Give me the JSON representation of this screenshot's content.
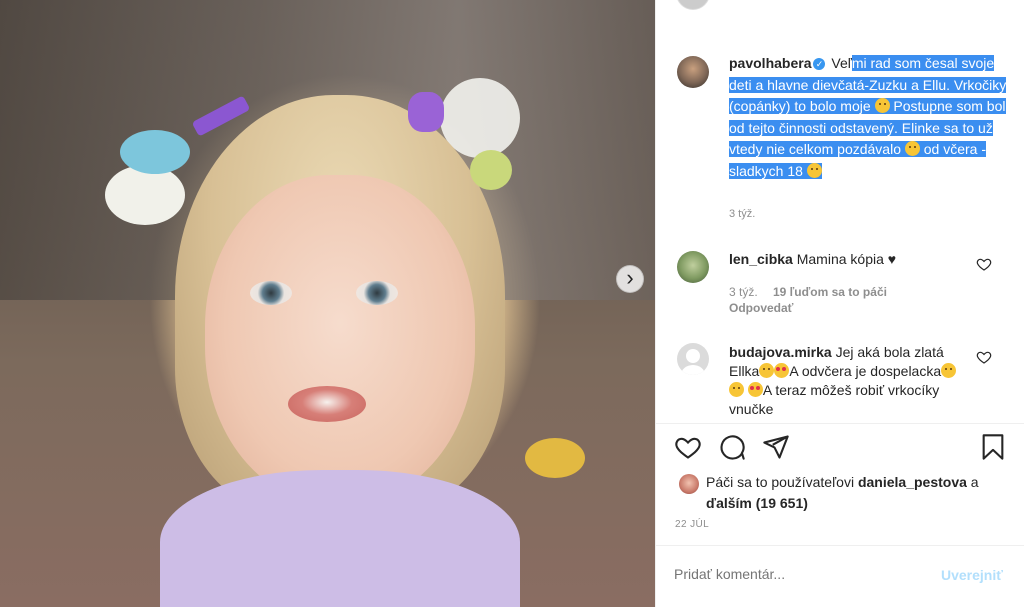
{
  "post": {
    "author": "pavolhabera",
    "caption_plain": "Veľ",
    "caption_highlighted_1": "mi rad som česal svoje deti a hlavne dievčatá-Zuzku a Ellu. Vrkočiky (copánky) to bolo moje ",
    "caption_highlighted_2": " Postupne som bol od tejto činnosti odstavený. Elinke sa to už vtedy nie celkom pozdávalo ",
    "caption_highlighted_3": " od včera - sladkych 18 ",
    "caption_time": "3 týž.",
    "likes_prefix": "Páči sa to používateľovi",
    "likes_user": "daniela_pestova",
    "likes_mid": "a",
    "likes_rest": "ďalším (19 651)",
    "date": "22 JÚL"
  },
  "comments": [
    {
      "user": "len_cibka",
      "text": "Mamina kópia ♥",
      "time": "3 týž.",
      "likes": "19 ľuďom sa to páči",
      "reply": "Odpovedať"
    },
    {
      "user": "budajova.mirka",
      "text_1": "Jej aká bola zlatá Ellka",
      "text_2": "A odvčera je dospelacka",
      "text_3": "A teraz môžeš robiť vrkocíky vnučke"
    }
  ],
  "composer": {
    "placeholder": "Pridať komentár...",
    "post_label": "Uverejniť"
  },
  "icons": {
    "like": "heart-icon",
    "comment": "comment-icon",
    "share": "share-icon",
    "save": "bookmark-icon",
    "next": "chevron-right-icon"
  },
  "colors": {
    "highlight": "#3b8ef0",
    "verified": "#3897f0",
    "muted": "#8e8e8e",
    "post_disabled": "#b2dffc"
  }
}
